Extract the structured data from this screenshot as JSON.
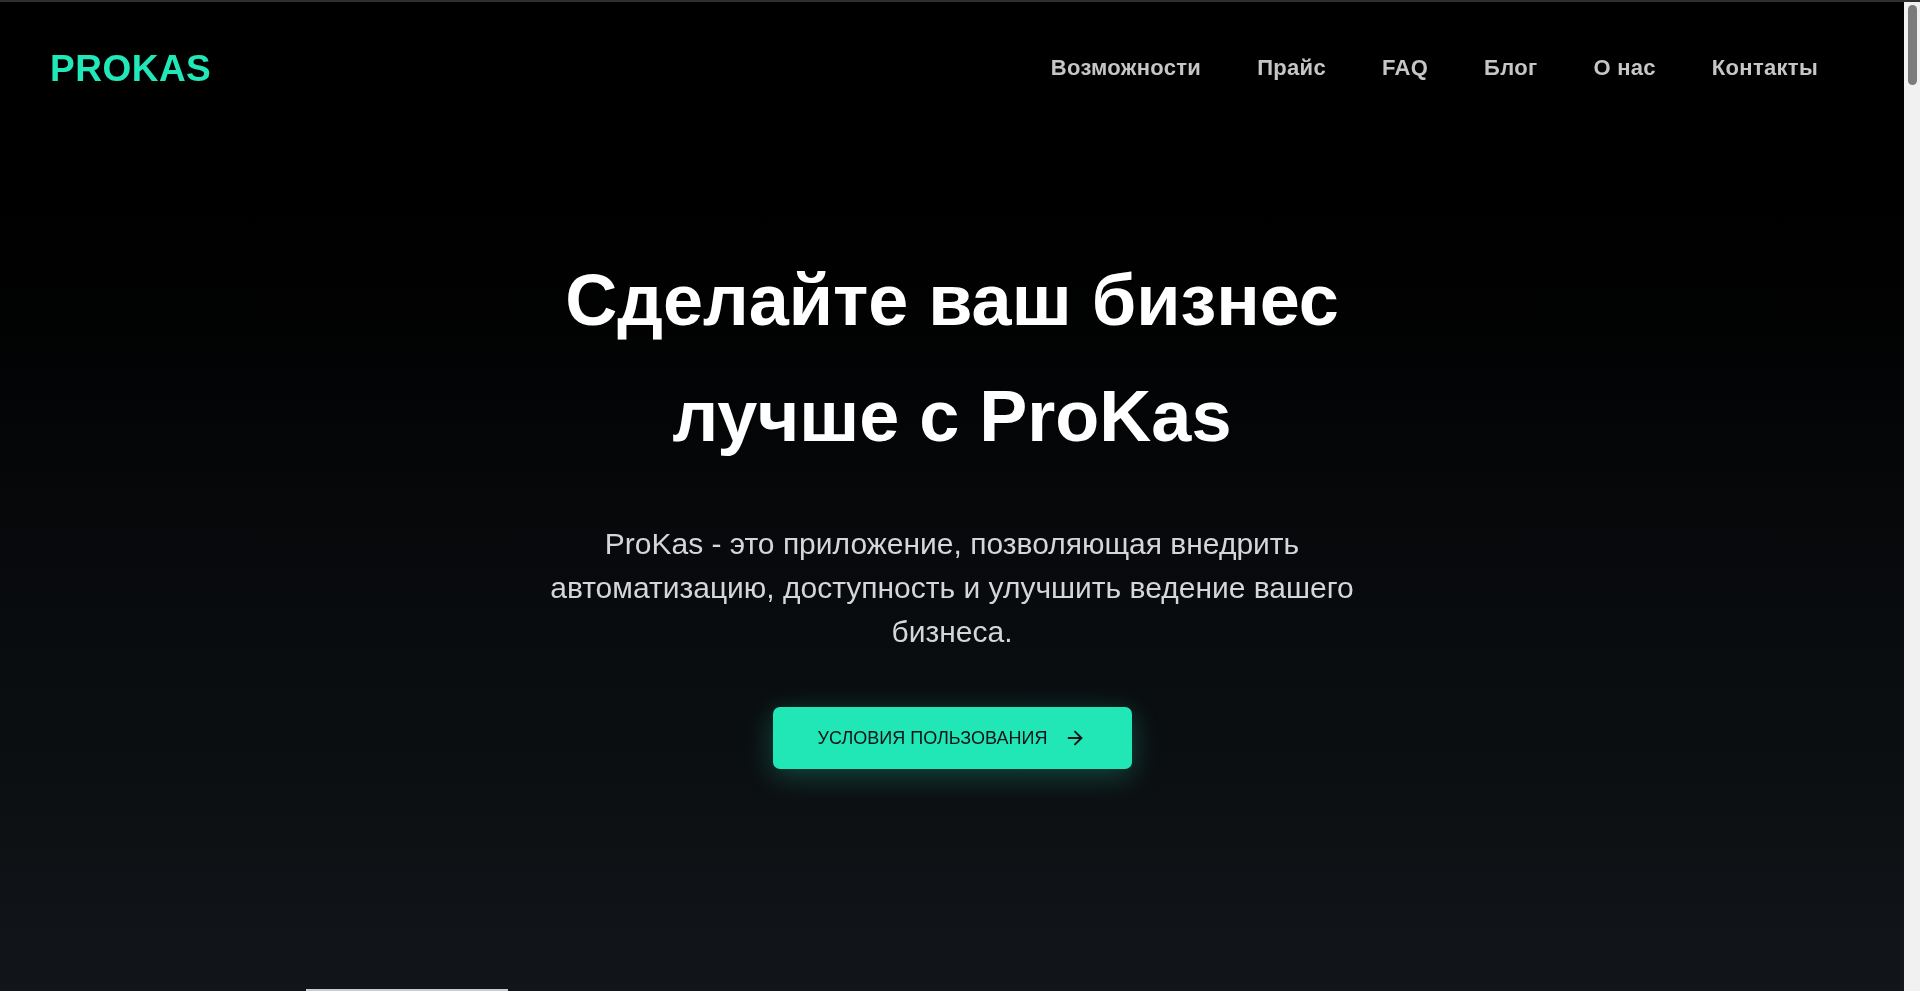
{
  "header": {
    "logo": "PROKAS",
    "nav": [
      {
        "label": "Возможности"
      },
      {
        "label": "Прайс"
      },
      {
        "label": "FAQ"
      },
      {
        "label": "Блог"
      },
      {
        "label": "О нас"
      },
      {
        "label": "Контакты"
      }
    ]
  },
  "hero": {
    "title": "Сделайте ваш бизнес лучше с ProKas",
    "description": "ProKas - это приложение, позволяющая внедрить автоматизацию, доступность и улучшить ведение вашего бизнеса.",
    "cta": {
      "label": "УСЛОВИЯ ПОЛЬЗОВАНИЯ"
    }
  }
}
